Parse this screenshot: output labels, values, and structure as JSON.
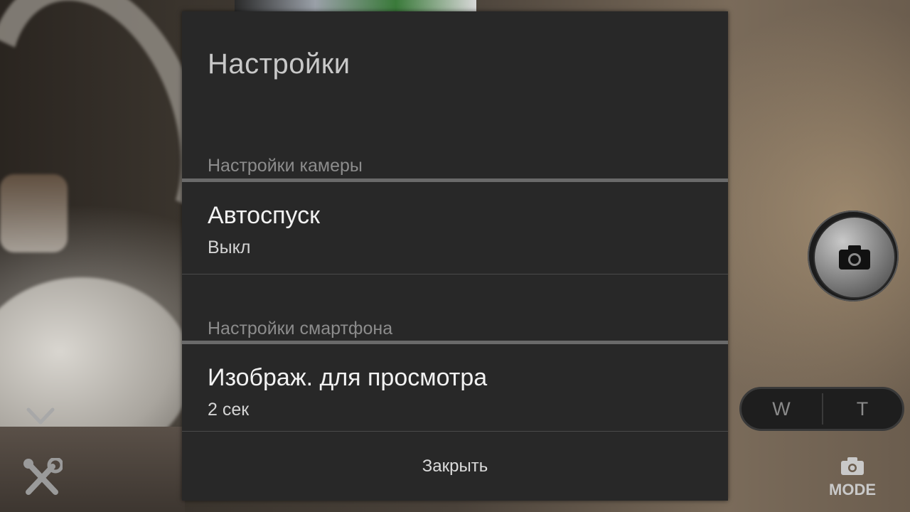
{
  "dialog": {
    "title": "Настройки",
    "sections": [
      {
        "header": "Настройки камеры",
        "items": [
          {
            "title": "Автоспуск",
            "summary": "Выкл"
          }
        ]
      },
      {
        "header": "Настройки смартфона",
        "items": [
          {
            "title": "Изображ. для просмотра",
            "summary": "2 сек"
          }
        ]
      }
    ],
    "close_label": "Закрыть"
  },
  "controls": {
    "zoom_wide": "W",
    "zoom_tele": "T",
    "mode_label": "MODE",
    "icons": [
      "chevron-down-icon",
      "tools-icon",
      "camera-icon",
      "mode-camera-icon"
    ]
  },
  "colors": {
    "dialog_bg": "#282828",
    "section_header": "#8c8c8c",
    "title_text": "#c8c8c8"
  }
}
